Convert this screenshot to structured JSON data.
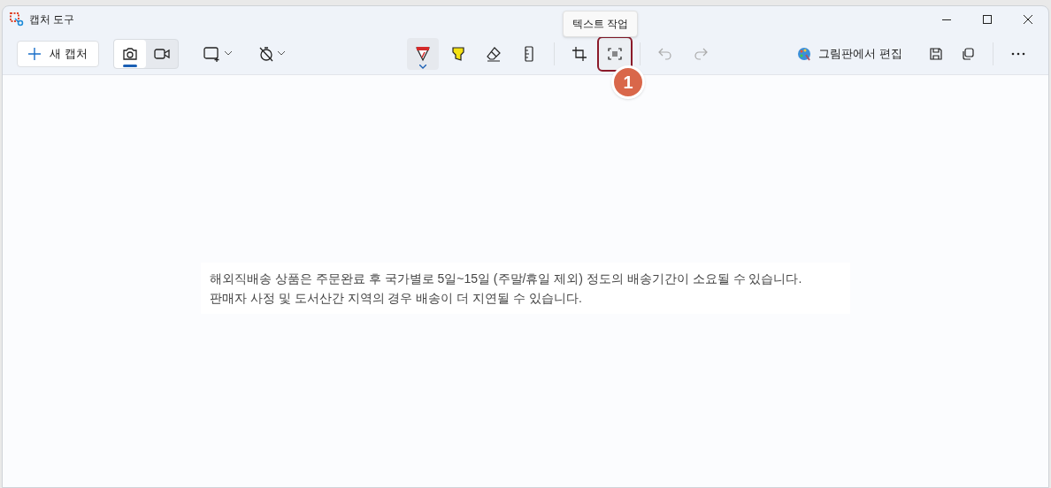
{
  "window": {
    "title": "캡처 도구"
  },
  "toolbar": {
    "new_capture": "새 캡처",
    "modes": [
      {
        "kind": "camera",
        "selected": true
      },
      {
        "kind": "video",
        "selected": false
      }
    ],
    "tools": [
      {
        "kind": "pen",
        "selected": true,
        "highlighted": false
      },
      {
        "kind": "highlighter",
        "selected": false,
        "highlighted": false
      },
      {
        "kind": "eraser",
        "selected": false,
        "highlighted": false
      },
      {
        "kind": "ruler",
        "selected": false,
        "highlighted": false
      },
      {
        "kind": "crop",
        "selected": false,
        "highlighted": false
      },
      {
        "kind": "text-actions",
        "selected": false,
        "highlighted": true
      },
      {
        "kind": "undo",
        "selected": false,
        "highlighted": false
      },
      {
        "kind": "redo",
        "selected": false,
        "highlighted": false
      }
    ],
    "tooltip": "텍스트 작업",
    "badge": "1",
    "edit_in_paint": "그림판에서 편집"
  },
  "capture": {
    "lines": [
      "해외직배송 상품은 주문완료 후 국가별로 5일~15일 (주말/휴일 제외) 정도의 배송기간이 소요될 수 있습니다.",
      "판매자 사정 및 도서산간 지역의 경우 배송이 더 지연될 수 있습니다."
    ]
  }
}
